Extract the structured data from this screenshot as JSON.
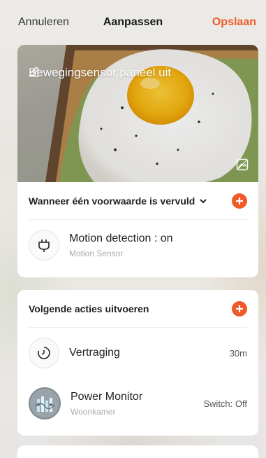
{
  "header": {
    "cancel_label": "Annuleren",
    "title": "Aanpassen",
    "save_label": "Opslaan"
  },
  "scene": {
    "name": "Bewegingsensor paneel uit"
  },
  "conditions": {
    "heading": "Wanneer één voorwaarde is vervuld",
    "items": [
      {
        "title": "Motion detection : on",
        "subtitle": "Motion Sensor"
      }
    ]
  },
  "actions": {
    "heading": "Volgende acties uitvoeren",
    "items": [
      {
        "title": "Vertraging",
        "value": "30m"
      },
      {
        "title": "Power Monitor",
        "subtitle": "Woonkamer",
        "value": "Switch: Off"
      }
    ]
  },
  "colors": {
    "accent": "#f05a28",
    "card": "#ffffff",
    "text": "#222222",
    "subtext": "#aaaaaa"
  },
  "icons": {
    "edit": "pencil-icon",
    "change_image": "image-icon",
    "add": "plus-icon",
    "dropdown": "chevron-down-icon",
    "condition": "plug-icon",
    "delay": "timer-icon",
    "device": "power-monitor-icon"
  }
}
